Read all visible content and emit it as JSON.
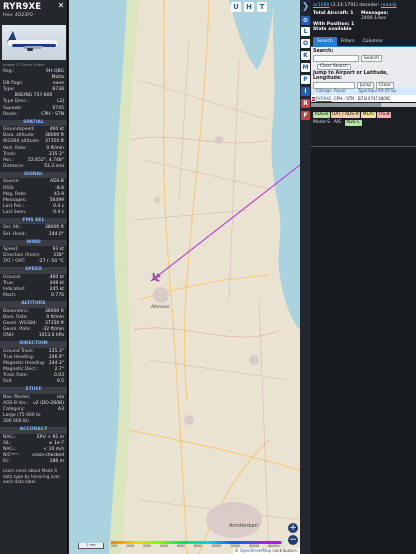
{
  "aircraft": {
    "callsign": "RYR9XE",
    "hex_line": "Hex: 4D23F0",
    "photo_credit": "Image © Gerrit Griem",
    "registration": [
      "Reg.:",
      "9H-QBG"
    ],
    "country": "Malta",
    "db_flags": [
      "DB flags:",
      "none"
    ],
    "type": [
      "Type:",
      "B738"
    ],
    "type_full": "BOEING 737-800",
    "type_desc": [
      "Type Desc.:",
      "L2J"
    ],
    "squawk": [
      "Squawk:",
      "0745"
    ],
    "route": [
      "Route:",
      "CPH - STN"
    ],
    "close_icon": "close-icon"
  },
  "sections": {
    "spatial": {
      "title": "SPATIAL",
      "rows": [
        [
          "Groundspeed:",
          "460 kt"
        ],
        [
          "Baro. altitude:",
          "38000 ft"
        ],
        [
          "WGS84 altitude:",
          "37350 ft"
        ],
        [
          "Vert. Rate:",
          "0 ft/min"
        ],
        [
          "Track:",
          "235.3°"
        ],
        [
          "Pos.:",
          "52.652°, 4.748°"
        ],
        [
          "Distance:",
          "53.3 nmi"
        ]
      ]
    },
    "signal": {
      "title": "SIGNAL",
      "rows": [
        [
          "Source:",
          "ADS-B"
        ],
        [
          "RSSI:",
          "-8.8"
        ],
        [
          "Msg. Rate:",
          "43.9"
        ],
        [
          "Messages:",
          "56499"
        ],
        [
          "Last Pos.:",
          "0.4 s"
        ],
        [
          "Last Seen:",
          "0.4 s"
        ]
      ]
    },
    "fms": {
      "title": "FMS SEL",
      "rows": [
        [
          "Sel. Alt.:",
          "38000 ft"
        ],
        [
          "Sel. Head.:",
          "244.0°"
        ]
      ]
    },
    "wind": {
      "title": "WIND",
      "rows": [
        [
          "Speed:",
          "93 kt"
        ],
        [
          "Direction (from):",
          "338°"
        ],
        [
          "TAT / OAT:",
          "-27 / -54 °C"
        ]
      ]
    },
    "speed": {
      "title": "SPEED",
      "rows": [
        [
          "Ground:",
          "460 kt"
        ],
        [
          "True:",
          "448 kt"
        ],
        [
          "Indicated:",
          "245 kt"
        ],
        [
          "Mach:",
          "0.776"
        ]
      ]
    },
    "altitude": {
      "title": "ALTITUDE",
      "rows": [
        [
          "Barometric:",
          "38000 ft"
        ],
        [
          "Baro. Rate:",
          "0 ft/min"
        ],
        [
          "Geom. WGS84:",
          "37350 ft"
        ],
        [
          "Geom. Rate:",
          "-32 ft/min"
        ],
        [
          "QNH:",
          "1013.6 hPa"
        ]
      ]
    },
    "direction": {
      "title": "DIRECTION",
      "rows": [
        [
          "Ground Track:",
          "235.3°"
        ],
        [
          "True Heading:",
          "246.9°"
        ],
        [
          "Magnetic Heading:",
          "244.3°"
        ],
        [
          "Magnetic Decl.:",
          "2.7°"
        ],
        [
          "Track Rate:",
          "0.03"
        ],
        [
          "Roll:",
          "0.5"
        ]
      ]
    },
    "stuff": {
      "title": "STUFF",
      "rows": [
        [
          "Nav. Modes:",
          "n/a"
        ],
        [
          "ADS-B Ver.:",
          "v2 (DO-260B)"
        ],
        [
          "Category:",
          "A3"
        ]
      ],
      "category_desc_1": "Large (75 000 to",
      "category_desc_2": "300 000 lb)"
    },
    "accuracy": {
      "title": "ACCURACY",
      "rows": [
        [
          "NACₚ:",
          "EPU < 92 m"
        ],
        [
          "SIL:",
          "≤ 1e-7"
        ],
        [
          "NACᵥ:",
          "< 10 m/s"
        ],
        [
          "NICᵇᵃʳᵒ:",
          "cross-checked"
        ],
        [
          "Rᴄ:",
          "186 m"
        ]
      ]
    },
    "footer": "Learn more about Mode S data type by hovering over each data label."
  },
  "map": {
    "buttons": [
      "U",
      "H",
      "T"
    ],
    "zoom_in": "+",
    "zoom_out": "−",
    "scale": "2 nm",
    "altitude_legend_ticks": [
      "500",
      "1000",
      "2000",
      "4000",
      "6000",
      "8000",
      "10000",
      "20000",
      "30000",
      "40000+"
    ],
    "attribution_prefix": "© ",
    "attribution_link": "OpenStreetMap",
    "attribution_suffix": " contributors.",
    "places": [
      "Alkmaar",
      "Amsterdam"
    ]
  },
  "toolbar": {
    "top_arrow": "❯",
    "buttons": [
      "L",
      "O",
      "K",
      "M",
      "P",
      "I",
      "R",
      "F"
    ],
    "settings_icon": "gear-icon"
  },
  "right_panel": {
    "version_link": "ar1090",
    "version_text": " (3.14.1791) decoder: ",
    "decoder_link": "readsb",
    "total_aircraft": "Total Aircraft: 1",
    "messages_label": "Messages:",
    "messages_value": "2490.1/sec",
    "with_position": "With Position: 1",
    "stats_available": "Stats available",
    "tabs": [
      "Search",
      "Filters",
      "Columns"
    ],
    "search_title": "Search:",
    "search_button": "Search",
    "clear_search": "Clear Search",
    "jump_title": "Jump to Airport or Latitude, Longitude:",
    "jump_button": "Jump",
    "clear_button": "Clear",
    "table_headers": [
      "",
      "Callsign",
      "Route",
      "Type",
      "Squawk",
      "Alt.(ft)",
      "Sp"
    ],
    "table_rows": [
      [
        "",
        "RYR9XE",
        "CPH - STN",
        "B738",
        "0745",
        "38000",
        ""
      ]
    ],
    "legend_badges": [
      {
        "text": "ADS-B",
        "color": "#b7e4a4"
      },
      {
        "text": "UAT / ADS-R",
        "color": "#f0d0a0"
      },
      {
        "text": "MLAT",
        "color": "#f6e49a"
      },
      {
        "text": "TIS-B",
        "color": "#f7b3b3"
      }
    ],
    "legend_text": [
      "Mode-S",
      "AIS"
    ],
    "legend_badge_2": {
      "text": "ADS-C",
      "color": "#b7e4a4"
    }
  }
}
